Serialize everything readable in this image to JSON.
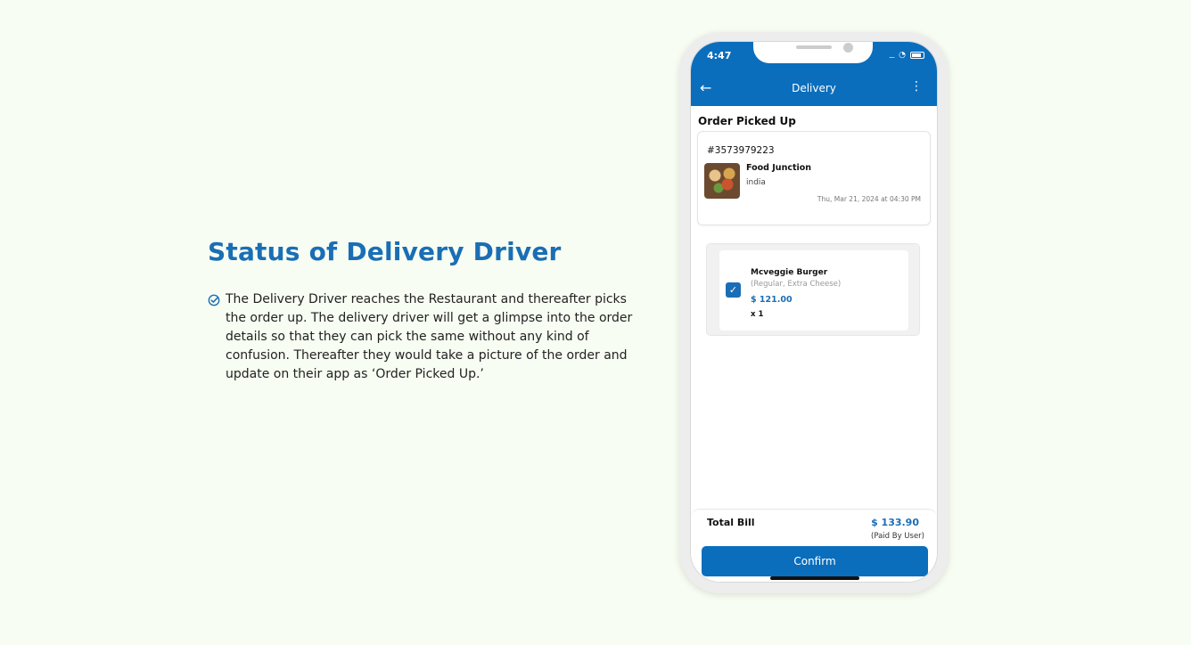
{
  "heading": "Status of Delivery Driver",
  "description": "The Delivery Driver reaches the Restaurant and thereafter picks the order up. The delivery driver will get a glimpse into the order details so that they can pick the same without any kind of confusion. Thereafter they would take a picture of the order and update on their app as ‘Order Picked Up.’",
  "phone": {
    "status_time": "4:47",
    "appbar_title": "Delivery",
    "section_title": "Order Picked Up",
    "order": {
      "id": "#3573979223",
      "restaurant": "Food Junction",
      "location": "india",
      "date": "Thu, Mar 21, 2024 at 04:30 PM"
    },
    "item": {
      "name": "Mcveggie Burger",
      "options": "(Regular, Extra Cheese)",
      "price": "$ 121.00",
      "qty": "x 1"
    },
    "total_label": "Total Bill",
    "total_amount": "$ 133.90",
    "paid_by": "(Paid By User)",
    "confirm_label": "Confirm"
  },
  "icons": {
    "check": "check-circle-icon",
    "back": "arrow-left-icon",
    "more": "more-vertical-icon",
    "checkbox": "checkbox-checked-icon"
  },
  "colors": {
    "background": "#f7fdf2",
    "accent": "#1a6eb5",
    "appbar": "#0a6ebd"
  }
}
